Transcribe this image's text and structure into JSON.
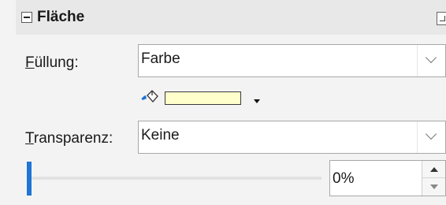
{
  "panel": {
    "title": "Fläche"
  },
  "fill": {
    "label_mnemonic": "F",
    "label_rest": "üllung:",
    "value": "Farbe",
    "color": "#ffffcc"
  },
  "transparency": {
    "label_mnemonic": "T",
    "label_rest": "ransparenz:",
    "value": "Keine",
    "percent_text": "0%",
    "level": 0
  },
  "icons": {
    "collapse": "minus-square-icon",
    "more_options": "more-options-icon",
    "fill_tool": "paint-bucket-icon",
    "color_picker_arrow": "triangle-down-icon",
    "accent": "#1f74d4"
  }
}
